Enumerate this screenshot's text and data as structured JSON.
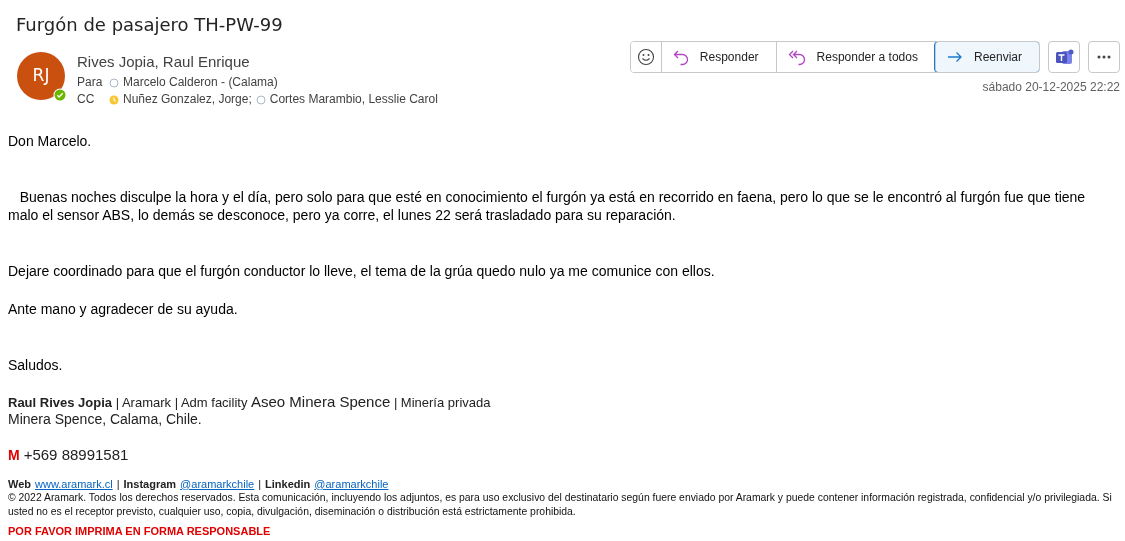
{
  "title": "Furgón de pasajero TH-PW-99",
  "sender": {
    "initials": "RJ",
    "name": "Rives Jopia, Raul Enrique",
    "kind": "available"
  },
  "to": {
    "label": "Para",
    "people": [
      {
        "name": "Marcelo Calderon - (Calama)",
        "kind": "unknown"
      }
    ]
  },
  "cc": {
    "label": "CC",
    "people": [
      {
        "name": "Nuñez Gonzalez, Jorge;",
        "kind": "away"
      },
      {
        "name": "Cortes Marambio, Lesslie Carol",
        "kind": "unknown"
      }
    ]
  },
  "actions": [
    {
      "kind": "emoji"
    },
    {
      "kind": "reply",
      "label": "Responder",
      "selected": false
    },
    {
      "kind": "reply_all",
      "label": "Responder a todos",
      "selected": false
    },
    {
      "kind": "forward",
      "label": "Reenviar",
      "selected": true
    }
  ],
  "extra_buttons": [
    {
      "kind": "teams"
    },
    {
      "kind": "more"
    }
  ],
  "date": "sábado 20-12-2025 22:22",
  "body": [
    {
      "text": "Don Marcelo.",
      "kind": "first"
    },
    {
      "text": "   Buenas noches disculpe la hora y el día, pero solo para que esté en conocimiento el furgón ya está en recorrido en faena, pero lo que se le encontró al furgón fue que tiene malo el sensor ABS, lo demás se desconoce, pero ya corre, el lunes 22 será trasladado para su reparación.",
      "kind": "double_spaced"
    },
    {
      "text": "Dejare coordinado para que el furgón conductor lo lleve, el tema de la grúa quedo nulo ya me comunice con ellos.",
      "kind": "double_spaced"
    },
    {
      "text": "Ante mano y agradecer de su ayuda.",
      "kind": "spaced"
    },
    {
      "text": "Saludos.",
      "kind": "double_spaced"
    }
  ],
  "signature": {
    "line1": [
      {
        "kind": "bold",
        "text": "Raul Rives Jopia"
      },
      {
        "kind": "normal",
        "text": " | Aramark | Adm facility "
      },
      {
        "kind": "large",
        "text": "Aseo Minera Spence"
      },
      {
        "kind": "normal",
        "text": " | Minería privada"
      }
    ],
    "line2": "Minera Spence, Calama, Chile.",
    "phone_label": "M",
    "phone": "+569 88991581",
    "links": [
      {
        "kind": "label",
        "text": "Web"
      },
      {
        "kind": "link",
        "text": "www.aramark.cl"
      },
      {
        "kind": "sep",
        "text": "|"
      },
      {
        "kind": "label",
        "text": "Instagram"
      },
      {
        "kind": "link",
        "text": "@aramarkchile"
      },
      {
        "kind": "sep",
        "text": "|"
      },
      {
        "kind": "label",
        "text": "Linkedin"
      },
      {
        "kind": "link",
        "text": "@aramarkchile"
      }
    ],
    "disclaimer": "© 2022 Aramark. Todos los derechos reservados. Esta comunicación, incluyendo los adjuntos, es para uso exclusivo del destinatario según fuere enviado por Aramark y puede contener información registrada, confidencial y/o privilegiada. Si usted no es el receptor previsto, cualquier uso, copia, divulgación, diseminación o distribución está estrictamente prohibida.",
    "notice": "POR FAVOR IMPRIMA EN FORMA RESPONSABLE"
  }
}
